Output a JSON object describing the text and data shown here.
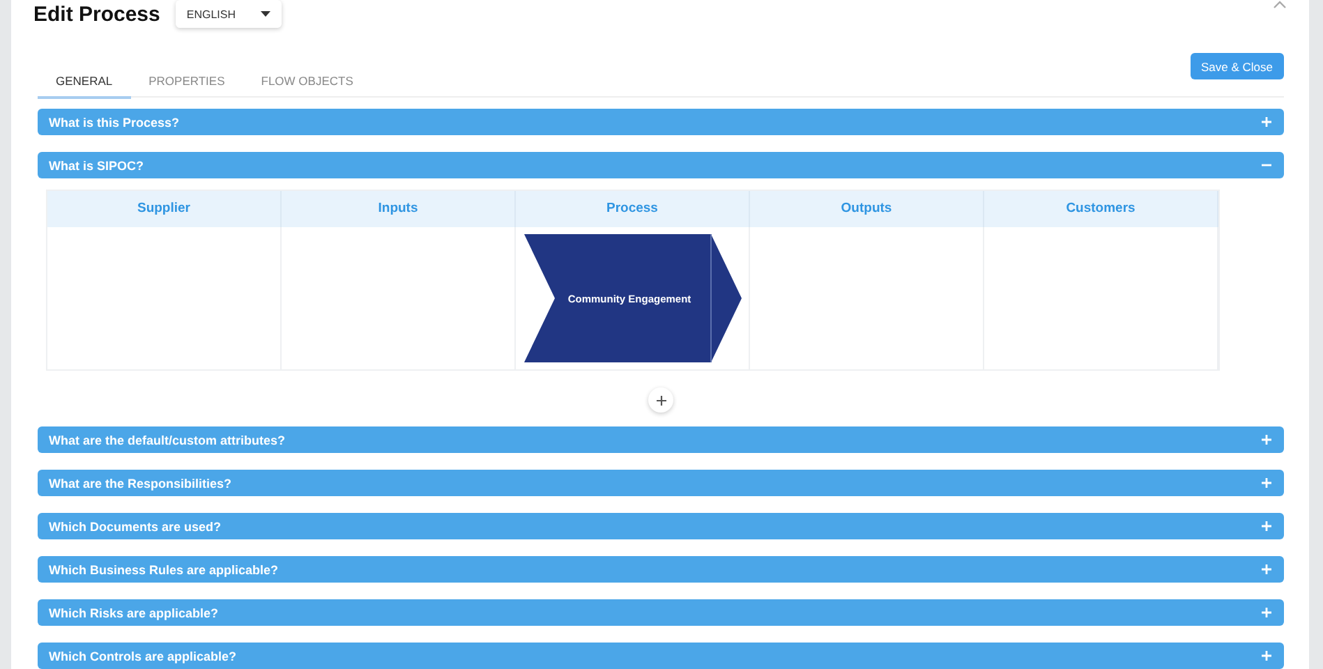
{
  "dialog": {
    "title": "Edit Process",
    "language": "ENGLISH"
  },
  "tabs": [
    {
      "label": "GENERAL",
      "selected": true
    },
    {
      "label": "PROPERTIES",
      "selected": false
    },
    {
      "label": "FLOW OBJECTS",
      "selected": false
    }
  ],
  "save_button": "Save & Close",
  "sections": [
    {
      "title": "What is this Process?",
      "expanded": false
    },
    {
      "title": "What is SIPOC?",
      "expanded": true,
      "sipoc": {
        "columns": [
          "Supplier",
          "Inputs",
          "Process",
          "Outputs",
          "Customers"
        ],
        "process_step": "Community Engagement"
      }
    },
    {
      "title": "What are the default/custom attributes?",
      "expanded": false
    },
    {
      "title": "What are the Responsibilities?",
      "expanded": false
    },
    {
      "title": "Which Documents are used?",
      "expanded": false
    },
    {
      "title": "Which Business Rules are applicable?",
      "expanded": false
    },
    {
      "title": "Which Risks are applicable?",
      "expanded": false
    },
    {
      "title": "Which Controls are applicable?",
      "expanded": false
    }
  ]
}
